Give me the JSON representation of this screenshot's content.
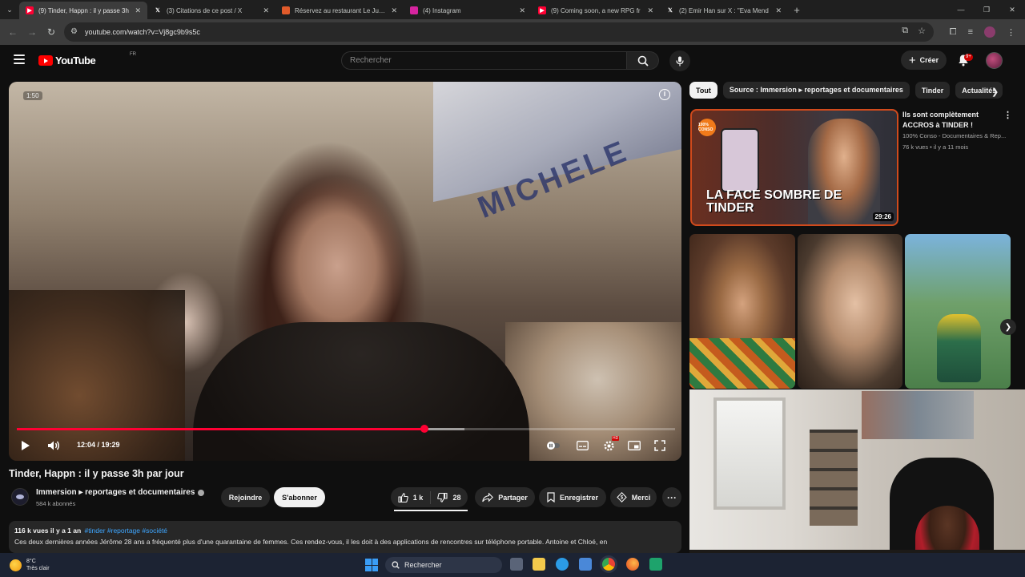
{
  "browser": {
    "tabs": [
      {
        "title": "(9) Tinder, Happn : il y passe 3h",
        "favicon": "youtube-icon",
        "color": "#ff0033",
        "active": true
      },
      {
        "title": "(3) Citations de ce post / X",
        "favicon": "x-icon",
        "color": "#ffffff",
        "active": false
      },
      {
        "title": "Réservez au restaurant Le Jules",
        "favicon": "restaurant-icon",
        "color": "#e05a2a",
        "active": false
      },
      {
        "title": "(4) Instagram",
        "favicon": "instagram-icon",
        "color": "#d6249f",
        "active": false
      },
      {
        "title": "(9) Coming soon, a new RPG fr",
        "favicon": "youtube-icon",
        "color": "#ff0033",
        "active": false
      },
      {
        "title": "(2) Emir Han sur X : \"Eva Mend",
        "favicon": "x-icon",
        "color": "#ffffff",
        "active": false
      }
    ],
    "url": "youtube.com/watch?v=Vj8gc9b9s5c"
  },
  "header": {
    "logo_text": "YouTube",
    "logo_region": "FR",
    "search_placeholder": "Rechercher",
    "create_label": "Créer",
    "notification_count": "9+"
  },
  "player": {
    "top_timestamp": "1:50",
    "timecode": "12:04 / 19:29",
    "progress": 0.619,
    "buffered": 0.68,
    "quality_badge": "HD",
    "scene_text": "MICHELE"
  },
  "video": {
    "title": "Tinder, Happn : il y passe 3h par jour",
    "channel_name": "Immersion ▸ reportages et documentaires",
    "subscribers": "584 k abonnés",
    "join_label": "Rejoindre",
    "subscribe_label": "S'abonner",
    "likes": "1 k",
    "dislikes": "28",
    "share_label": "Partager",
    "save_label": "Enregistrer",
    "thanks_label": "Merci",
    "views_date": "116 k vues  il y a 1 an",
    "tags": "#tinder #reportage #société",
    "description": "Ces deux dernières années Jérôme 28 ans a fréquenté plus d'une quarantaine de femmes. Ces rendez-vous, il les doit à des applications de rencontres sur téléphone portable. Antoine et Chloé, en"
  },
  "sidebar": {
    "chips": [
      "Tout",
      "Source : Immersion ▸ reportages et documentaires",
      "Tinder",
      "Actualités"
    ],
    "reco": {
      "title": "Ils sont complètement ACCROS à TINDER !",
      "channel": "100% Conso - Documentaires & Rep...",
      "meta": "76 k vues • il y a 11 mois",
      "overlay": "LA FACE SOMBRE DE TINDER",
      "duration": "29:26",
      "logo_text": "100% CONSO"
    }
  },
  "taskbar": {
    "temperature": "8°C",
    "weather": "Très clair",
    "search_label": "Rechercher"
  }
}
